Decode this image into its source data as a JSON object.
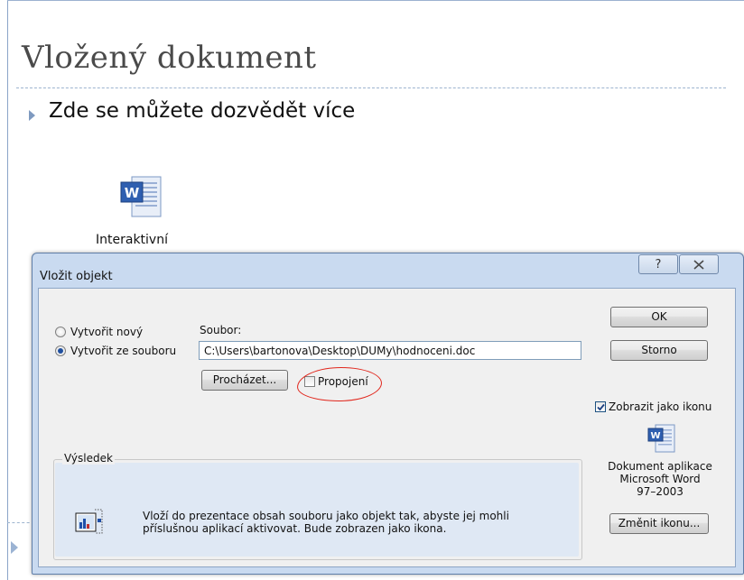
{
  "slide": {
    "title": "Vložený dokument",
    "bullet": "Zde se můžete dozvědět více",
    "embedded_label": "Interaktivní"
  },
  "dialog": {
    "title": "Vložit objekt",
    "help_symbol": "?",
    "options": {
      "create_new": "Vytvořit nový",
      "create_from_file": "Vytvořit ze souboru",
      "selected": "Vytvořit ze souboru"
    },
    "file": {
      "label": "Soubor:",
      "value": "C:\\Users\\bartonova\\Desktop\\DUMy\\hodnoceni.doc"
    },
    "browse_label": "Procházet...",
    "link_label": "Propojení",
    "link_checked": false,
    "ok_label": "OK",
    "cancel_label": "Storno",
    "show_as_icon_label": "Zobrazit jako ikonu",
    "show_as_icon_checked": true,
    "icon_caption": [
      "Dokument aplikace",
      "Microsoft Word",
      "97–2003"
    ],
    "change_icon_label": "Změnit ikonu...",
    "result": {
      "legend": "Výsledek",
      "text": "Vloží do prezentace obsah souboru jako objekt tak, abyste jej mohli příslušnou aplikací aktivovat. Bude zobrazen jako ikona."
    }
  },
  "colors": {
    "dialog_frame": "#c9daf0",
    "dialog_body": "#f0f0f0",
    "highlight_circle": "#e1261c",
    "radio_dot": "#1f4f9e"
  },
  "icons": [
    "word-document-icon",
    "close-icon",
    "help-icon",
    "result-preview-icon"
  ]
}
